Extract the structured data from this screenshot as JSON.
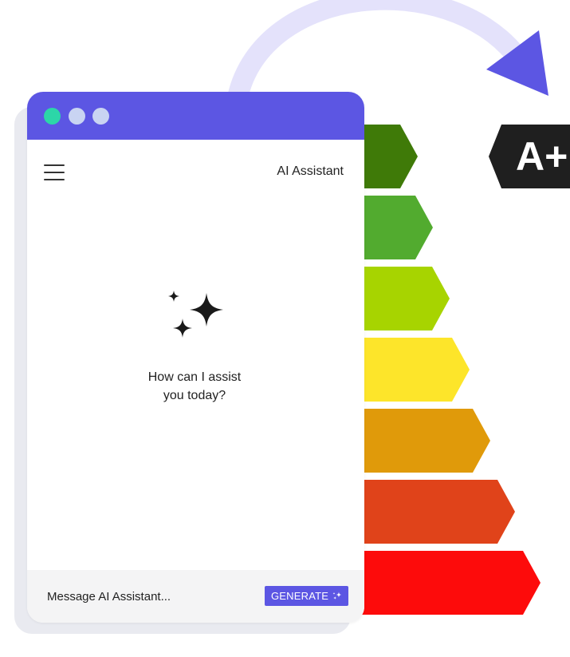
{
  "header": {
    "title": "AI Assistant",
    "menu_icon": "hamburger-menu-icon"
  },
  "window_controls": {
    "dot_colors": [
      "#2cd6a8",
      "#c9d4f2",
      "#c9d4f2"
    ]
  },
  "empty_state": {
    "icon": "sparkle-icon",
    "line1": "How can I assist",
    "line2": "you today?"
  },
  "composer": {
    "placeholder": "Message AI Assistant...",
    "generate_label": "GENERATE",
    "generate_icon": "sparkle-icon"
  },
  "energy_rating": {
    "current_rating": "A+",
    "bar_colors": [
      "#3f7a08",
      "#52ab2f",
      "#a7d400",
      "#fde52a",
      "#e09a0a",
      "#e0431a",
      "#fd0b0b"
    ]
  },
  "colors": {
    "accent": "#5c56e3",
    "arc": "#e4e2fb",
    "arrow": "#5c56e3"
  }
}
